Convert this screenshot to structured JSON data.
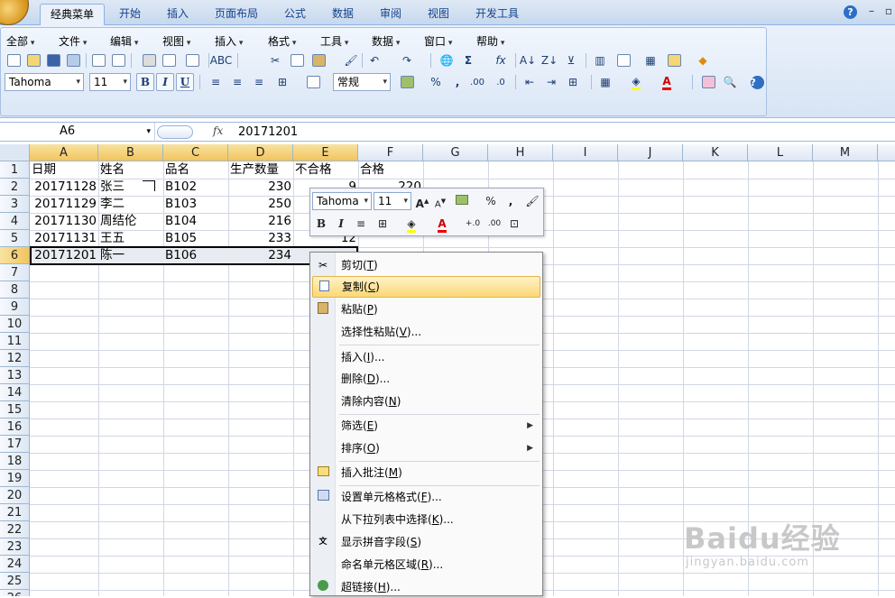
{
  "ribbon_tabs": [
    "经典菜单",
    "开始",
    "插入",
    "页面布局",
    "公式",
    "数据",
    "审阅",
    "视图",
    "开发工具"
  ],
  "menu": [
    "全部",
    "文件",
    "编辑",
    "视图",
    "插入",
    "格式",
    "工具",
    "数据",
    "窗口",
    "帮助"
  ],
  "font_name": "Tahoma",
  "font_size": "11",
  "number_format": "常规",
  "name_box": "A6",
  "fx_label": "fx",
  "formula_value": "20171201",
  "columns": [
    "A",
    "B",
    "C",
    "D",
    "E",
    "F",
    "G",
    "H",
    "I",
    "J",
    "K",
    "L",
    "M"
  ],
  "rows": [
    "1",
    "2",
    "3",
    "4",
    "5",
    "6",
    "7",
    "8",
    "9",
    "10",
    "11",
    "12",
    "13",
    "14",
    "15",
    "16",
    "17",
    "18",
    "19",
    "20",
    "21",
    "22",
    "23",
    "24",
    "25",
    "26"
  ],
  "cells": {
    "r1": [
      "日期",
      "姓名",
      "品名",
      "生产数量",
      "不合格",
      "合格"
    ],
    "r2": [
      "20171128",
      "张三",
      "B102",
      "230",
      "9",
      "220"
    ],
    "r3": [
      "20171129",
      "李二",
      "B103",
      "250",
      "",
      ""
    ],
    "r4": [
      "20171130",
      "周结伦",
      "B104",
      "216",
      "",
      ""
    ],
    "r5": [
      "20171131",
      "王五",
      "B105",
      "233",
      "12",
      ""
    ],
    "r6": [
      "20171201",
      "陈一",
      "B106",
      "234",
      "",
      ""
    ]
  },
  "mini_toolbar": {
    "font": "Tahoma",
    "size": "11",
    "bold": "B",
    "italic": "I",
    "percent": "%",
    "comma": ","
  },
  "context_menu": [
    {
      "label": "剪切",
      "key": "T",
      "icon": "scissors-icon"
    },
    {
      "label": "复制",
      "key": "C",
      "icon": "copy-icon",
      "highlighted": true
    },
    {
      "label": "粘贴",
      "key": "P",
      "icon": "paste-icon"
    },
    {
      "label": "选择性粘贴",
      "key": "V",
      "suffix": "..."
    },
    {
      "label": "插入",
      "key": "I",
      "suffix": "..."
    },
    {
      "label": "删除",
      "key": "D",
      "suffix": "..."
    },
    {
      "label": "清除内容",
      "key": "N"
    },
    {
      "label": "筛选",
      "key": "E",
      "submenu": true
    },
    {
      "label": "排序",
      "key": "O",
      "submenu": true
    },
    {
      "label": "插入批注",
      "key": "M",
      "icon": "comment-icon"
    },
    {
      "label": "设置单元格格式",
      "key": "F",
      "suffix": "...",
      "icon": "format-cells-icon"
    },
    {
      "label": "从下拉列表中选择",
      "key": "K",
      "suffix": "..."
    },
    {
      "label": "显示拼音字段",
      "key": "S",
      "icon": "phonetic-icon"
    },
    {
      "label": "命名单元格区域",
      "key": "R",
      "suffix": "..."
    },
    {
      "label": "超链接",
      "key": "H",
      "suffix": "...",
      "icon": "hyperlink-icon"
    }
  ],
  "watermark": {
    "brand": "Baidu经验",
    "url": "jingyan.baidu.com"
  },
  "colors": {
    "selection_header": "#f2c45c",
    "menu_highlight": "#fbd775",
    "ribbon": "#dbe7f6"
  }
}
